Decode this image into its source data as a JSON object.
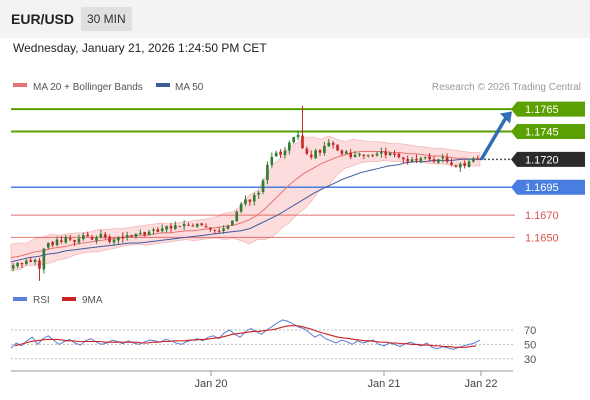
{
  "header": {
    "pair": "EUR/USD",
    "timeframe": "30 MIN"
  },
  "date_line": "Wednesday, January 21, 2026 1:24:50 PM CET",
  "legend": {
    "ma20": "MA 20 + Bollinger Bands",
    "ma50": "MA 50",
    "credit": "Research © 2026 Trading Central"
  },
  "rsi_legend": {
    "rsi": "RSI",
    "ma9": "9MA"
  },
  "colors": {
    "candle_up": "#2e7d32",
    "candle_down": "#c62828",
    "ma20": "#e57373",
    "bands": "#fbd0d0",
    "ma50": "#3f5c9e",
    "resistance": "#5aa000",
    "pivot": "#4a7de0",
    "support": "#d9534f",
    "rsi": "#5b7fd6",
    "rsi_ma": "#cc2222"
  },
  "chart_data": [
    {
      "type": "candlestick",
      "title": "",
      "price_range": [
        1.161,
        1.1775
      ],
      "x_ticks": [
        "Jan 20",
        "Jan 21",
        "Jan 22"
      ],
      "current_price": "1.1720",
      "levels": [
        {
          "value": 1.1765,
          "label": "1.1765",
          "kind": "resistance"
        },
        {
          "value": 1.1745,
          "label": "1.1745",
          "kind": "resistance"
        },
        {
          "value": 1.172,
          "label": "1.1720",
          "kind": "current"
        },
        {
          "value": 1.1695,
          "label": "1.1695",
          "kind": "pivot"
        },
        {
          "value": 1.167,
          "label": "1.1670",
          "kind": "support"
        },
        {
          "value": 1.165,
          "label": "1.1650",
          "kind": "support"
        }
      ],
      "close_path": [
        1.1625,
        1.1627,
        1.1626,
        1.1629,
        1.1628,
        1.163,
        1.1622,
        1.164,
        1.1645,
        1.1643,
        1.1648,
        1.1646,
        1.165,
        1.1648,
        1.1646,
        1.1649,
        1.1652,
        1.1651,
        1.1648,
        1.165,
        1.1653,
        1.165,
        1.1646,
        1.1648,
        1.165,
        1.1649,
        1.1652,
        1.1651,
        1.1653,
        1.1654,
        1.1652,
        1.1655,
        1.1657,
        1.1655,
        1.1658,
        1.166,
        1.1658,
        1.1661,
        1.166,
        1.1662,
        1.1661,
        1.166,
        1.1662,
        1.1661,
        1.1659,
        1.1657,
        1.1656,
        1.1655,
        1.1658,
        1.166,
        1.1665,
        1.1673,
        1.168,
        1.1684,
        1.1682,
        1.1688,
        1.169,
        1.1701,
        1.1715,
        1.1722,
        1.1726,
        1.1724,
        1.1728,
        1.1735,
        1.174,
        1.1742,
        1.173,
        1.1725,
        1.1722,
        1.1728,
        1.1726,
        1.1732,
        1.1735,
        1.1733,
        1.1728,
        1.1725,
        1.1727,
        1.1722,
        1.1724,
        1.1725,
        1.1723,
        1.1724,
        1.1723,
        1.1725,
        1.1727,
        1.1724,
        1.1726,
        1.1724,
        1.1722,
        1.172,
        1.1718,
        1.172,
        1.1719,
        1.1721,
        1.1722,
        1.172,
        1.1718,
        1.172,
        1.1722,
        1.1718,
        1.1715,
        1.1713,
        1.1716,
        1.1714,
        1.1718,
        1.1721,
        1.172
      ],
      "spike_high": 1.1768,
      "ma20": [
        1.1632,
        1.1633,
        1.1635,
        1.1637,
        1.1638,
        1.164,
        1.1641,
        1.1642,
        1.1644,
        1.1645,
        1.1646,
        1.1647,
        1.1648,
        1.1649,
        1.165,
        1.1651,
        1.1652,
        1.1652,
        1.1653,
        1.1654,
        1.1654,
        1.1655,
        1.1656,
        1.1656,
        1.1657,
        1.1658,
        1.1659,
        1.166,
        1.1661,
        1.1663,
        1.1666,
        1.167,
        1.1676,
        1.1683,
        1.169,
        1.1697,
        1.1703,
        1.1708,
        1.1712,
        1.1716,
        1.1719,
        1.1722,
        1.1724,
        1.1726,
        1.1727,
        1.1727,
        1.1727,
        1.1727,
        1.1726,
        1.1726,
        1.1725,
        1.1725,
        1.1724,
        1.1723,
        1.1723,
        1.1722,
        1.1721,
        1.1721,
        1.172,
        1.172
      ],
      "ma50": [
        1.1628,
        1.163,
        1.1632,
        1.1633,
        1.1635,
        1.1636,
        1.1638,
        1.1639,
        1.164,
        1.1641,
        1.1642,
        1.1643,
        1.1644,
        1.1645,
        1.1645,
        1.1646,
        1.1647,
        1.1648,
        1.1649,
        1.165,
        1.1651,
        1.1652,
        1.1653,
        1.1654,
        1.1655,
        1.1656,
        1.1658,
        1.1662,
        1.1666,
        1.167,
        1.1675,
        1.168,
        1.1685,
        1.169,
        1.1694,
        1.1698,
        1.1702,
        1.1705,
        1.1708,
        1.171,
        1.1712,
        1.1714,
        1.1715,
        1.1717,
        1.1718,
        1.1718,
        1.1719,
        1.1719,
        1.1719,
        1.172,
        1.172,
        1.172
      ],
      "band_width": [
        0.0012,
        0.001,
        0.0012,
        0.0013,
        0.0011,
        0.001,
        0.0009,
        0.001,
        0.0009,
        0.0008,
        0.0008,
        0.0009,
        0.0009,
        0.0008,
        0.0008,
        0.0009,
        0.0009,
        0.001,
        0.0012,
        0.0016,
        0.0022,
        0.0028,
        0.0032,
        0.0034,
        0.0032,
        0.0028,
        0.0022,
        0.0016,
        0.0012,
        0.001,
        0.0009,
        0.0008,
        0.0008,
        0.0008,
        0.0007,
        0.0007,
        0.0007,
        0.0007,
        0.0006,
        0.0006
      ]
    },
    {
      "type": "line",
      "title": "",
      "ylim": [
        20,
        95
      ],
      "y_ticks": [
        70,
        50,
        30
      ],
      "rsi": [
        45,
        52,
        48,
        55,
        60,
        50,
        58,
        62,
        56,
        50,
        54,
        57,
        52,
        49,
        55,
        58,
        53,
        50,
        52,
        56,
        54,
        51,
        55,
        52,
        50,
        53,
        56,
        55,
        53,
        57,
        55,
        52,
        50,
        54,
        56,
        58,
        55,
        60,
        62,
        58,
        66,
        70,
        64,
        60,
        68,
        72,
        68,
        64,
        70,
        75,
        80,
        84,
        82,
        78,
        74,
        72,
        66,
        60,
        64,
        58,
        55,
        52,
        56,
        54,
        50,
        55,
        52,
        54,
        56,
        50,
        48,
        52,
        50,
        47,
        51,
        53,
        50,
        48,
        52,
        46,
        44,
        47,
        45,
        43,
        46,
        48,
        50,
        52,
        56
      ],
      "ma9": [
        48,
        50,
        52,
        54,
        55,
        56,
        57,
        57,
        57,
        56,
        55,
        55,
        54,
        54,
        54,
        54,
        54,
        53,
        53,
        53,
        53,
        53,
        53,
        53,
        52,
        52,
        53,
        53,
        54,
        54,
        55,
        55,
        55,
        56,
        56,
        57,
        57,
        58,
        59,
        60,
        62,
        64,
        65,
        66,
        67,
        68,
        68,
        69,
        70,
        71,
        73,
        75,
        76,
        76,
        75,
        73,
        71,
        68,
        66,
        64,
        62,
        60,
        59,
        58,
        57,
        56,
        55,
        55,
        54,
        53,
        53,
        52,
        52,
        51,
        51,
        50,
        50,
        49,
        49,
        48,
        48,
        47,
        47,
        46,
        46,
        46,
        47,
        48
      ]
    }
  ]
}
